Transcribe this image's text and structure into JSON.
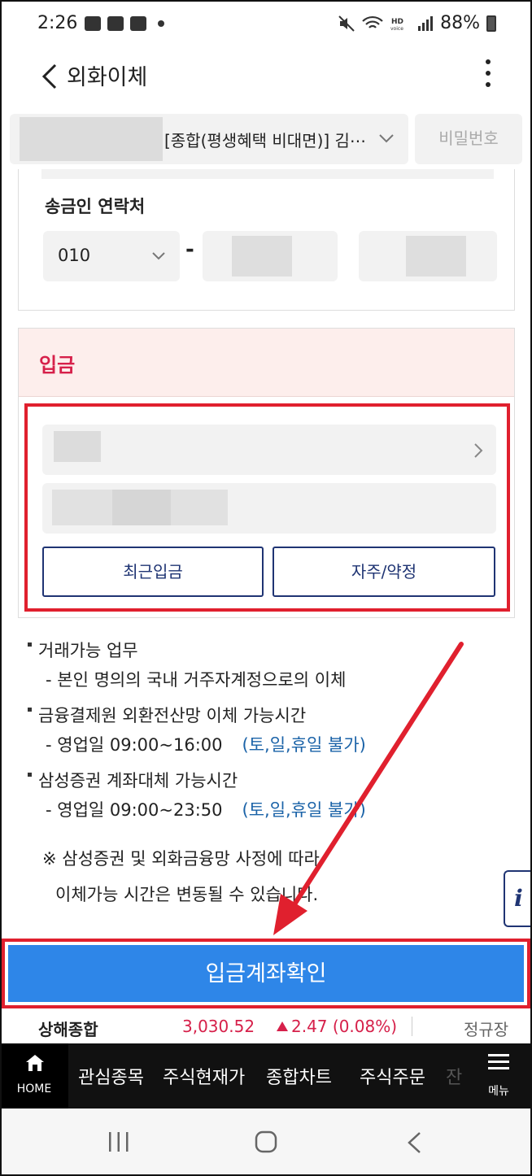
{
  "status_bar": {
    "time": "2:26",
    "battery": "88%"
  },
  "header": {
    "title": "외화이체"
  },
  "account": {
    "label": "[종합(평생혜택 비대면)]  김⋯",
    "password_button": "비밀번호"
  },
  "sender": {
    "label": "송금인 연락처",
    "phone_prefix": "010",
    "dash": "-"
  },
  "deposit": {
    "title": "입금",
    "recent_button": "최근입금",
    "frequent_button": "자주/약정"
  },
  "info": {
    "item1_title": "거래가능 업무",
    "item1_detail": "- 본인 명의의 국내 거주자계정으로의 이체",
    "item2_title": "금융결제원 외환전산망 이체 가능시간",
    "item2_detail": "- 영업일 09:00~16:00",
    "item2_note": "(토,일,휴일 불가)",
    "item3_title": "삼성증권 계좌대체 가능시간",
    "item3_detail": "- 영업일 09:00~23:50",
    "item3_note": "(토,일,휴일 불가)",
    "notice_line1": "※ 삼성증권 및 외화금융망 사정에 따라",
    "notice_line2": "이체가능 시간은 변동될 수 있습니다."
  },
  "side_info_button": "i",
  "primary_button": "입금계좌확인",
  "ticker": {
    "name": "상해종합",
    "value": "3,030.52",
    "change": "2.47 (0.08%)",
    "status": "정규장"
  },
  "bottom_nav": {
    "home": "HOME",
    "items": [
      "관심종목",
      "주식현재가",
      "종합차트",
      "주식주문"
    ],
    "faded": "잔",
    "menu": "메뉴"
  },
  "colors": {
    "primary": "#2e86e8",
    "accent_red": "#d6204a",
    "annotation_red": "#e0202e",
    "navy": "#1f3473",
    "info_blue": "#1b63a8"
  }
}
